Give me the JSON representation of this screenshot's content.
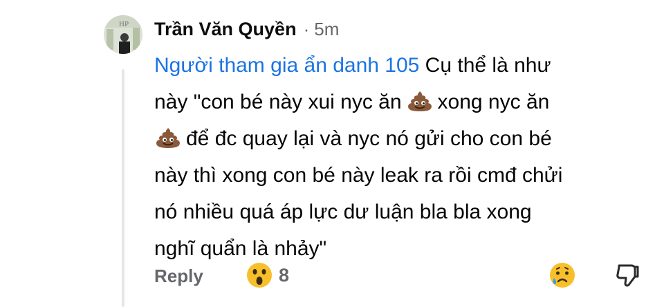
{
  "comment": {
    "author": "Trần Văn Quyền",
    "separator": "·",
    "timestamp": "5m",
    "mention": "Người tham gia ẩn danh 105",
    "line1_text": " Cụ thể là như",
    "line2_before": "này \"con bé này xui nyc ăn",
    "line2_after": "xong nyc ăn",
    "line3_after": "để đc quay lại và nyc nó gửi cho con bé",
    "line4": "này thì xong con bé này leak ra rồi cmđ chửi",
    "line5": "nó nhiều quá áp lực dư luận bla bla xong",
    "line6": "nghĩ quẩn là nhảy\"",
    "inline_emoji": "pile-of-poo-emoji"
  },
  "actions": {
    "reply_label": "Reply",
    "reaction_icon": "surprised-face-emoji",
    "reaction_count": "8",
    "sad_icon": "sad-face-emoji",
    "dislike_icon": "thumbs-down-icon"
  },
  "colors": {
    "mention": "#1b74e4",
    "secondary_text": "#65676b",
    "thread_line": "#e4e6ea"
  }
}
